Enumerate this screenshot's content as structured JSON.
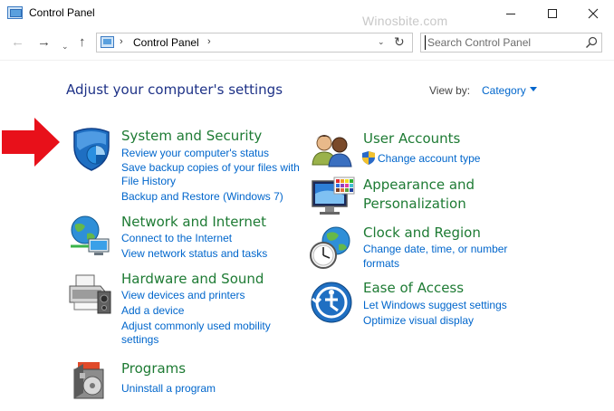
{
  "window": {
    "title": "Control Panel",
    "watermark": "Winosbite.com"
  },
  "nav": {
    "back": "←",
    "forward": "→",
    "recent": "⌄",
    "up": "↑",
    "address_sep": "›",
    "address_path": "Control Panel",
    "address_dropdown": "⌄",
    "refresh": "↻",
    "search_placeholder": "Search Control Panel"
  },
  "header": {
    "title": "Adjust your computer's settings",
    "view_by_label": "View by:",
    "view_by_value": "Category"
  },
  "categories": {
    "system_security": {
      "title": "System and Security",
      "links": [
        "Review your computer's status",
        "Save backup copies of your files with",
        "File History",
        "Backup and Restore (Windows 7)"
      ]
    },
    "network_internet": {
      "title": "Network and Internet",
      "links": [
        "Connect to the Internet",
        "View network status and tasks"
      ]
    },
    "hardware_sound": {
      "title": "Hardware and Sound",
      "links": [
        "View devices and printers",
        "Add a device",
        "Adjust commonly used mobility",
        "settings"
      ]
    },
    "programs": {
      "title": "Programs",
      "links": [
        "Uninstall a program"
      ]
    },
    "user_accounts": {
      "title": "User Accounts",
      "links": [
        "Change account type"
      ]
    },
    "appearance": {
      "title_line1": "Appearance and",
      "title_line2": "Personalization"
    },
    "clock_region": {
      "title": "Clock and Region",
      "links": [
        "Change date, time, or number",
        "formats"
      ]
    },
    "ease_access": {
      "title": "Ease of Access",
      "links": [
        "Let Windows suggest settings",
        "Optimize visual display"
      ]
    }
  },
  "colors": {
    "category_title": "#1e7b34",
    "link": "#0066cc",
    "heading": "#1e3287",
    "annotation_arrow": "#e8101a"
  },
  "icons": {
    "system_security": "shield-icon",
    "network_internet": "globe-network-icon",
    "hardware_sound": "printer-speaker-icon",
    "programs": "programs-box-icon",
    "user_accounts": "users-icon",
    "appearance": "monitor-colors-icon",
    "clock_region": "clock-globe-icon",
    "ease_access": "ease-of-access-icon",
    "uac": "uac-shield-icon",
    "annotation": "red-arrow-icon"
  }
}
